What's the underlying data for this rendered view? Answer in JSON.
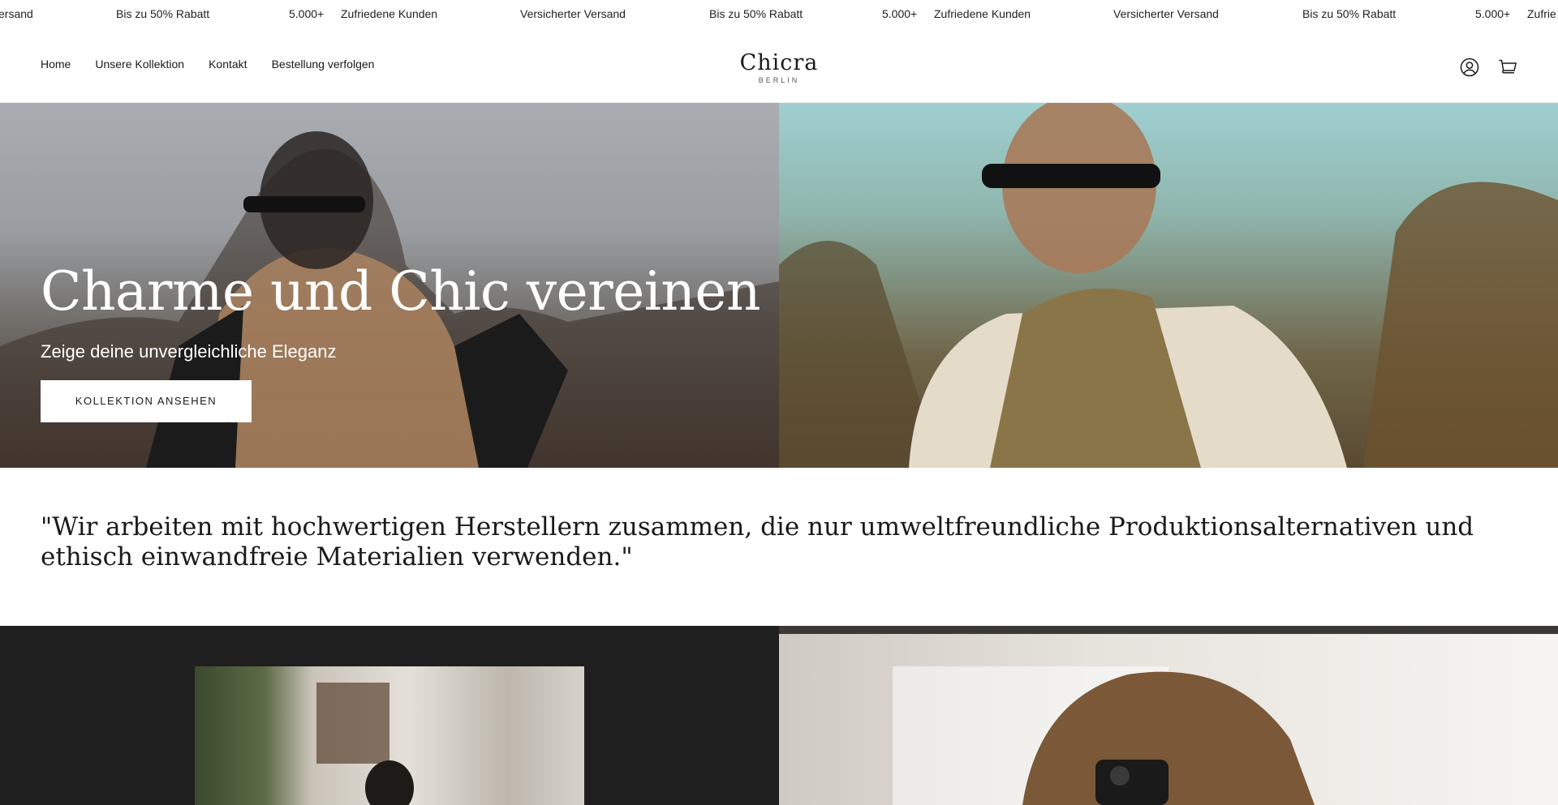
{
  "announcement": {
    "items": [
      "ersand",
      "Bis zu 50% Rabatt",
      "5.000+",
      "Zufriedene Kunden",
      "Versicherter Versand",
      "Bis zu 50% Rabatt",
      "5.000+",
      "Zufriedene Kunden",
      "Versicherter Versand",
      "Bis zu 50% Rabatt",
      "5.000+",
      "Zufrie"
    ]
  },
  "header": {
    "nav": [
      "Home",
      "Unsere Kollektion",
      "Kontakt",
      "Bestellung verfolgen"
    ],
    "logo": {
      "word": "Chicra",
      "sub": "BERLIN"
    },
    "icons": [
      "account-icon",
      "cart-icon"
    ]
  },
  "hero": {
    "title": "Charme und Chic vereinen",
    "subtitle": "Zeige deine unvergleichliche Eleganz",
    "button": "KOLLEKTION ANSEHEN"
  },
  "quote": {
    "text": "\"Wir arbeiten mit hochwertigen Herstellern zusammen, die nur umweltfreundliche Produktionsalternativen und ethisch einwandfreie Materialien verwenden.\""
  },
  "colors": {
    "dark_panel": "#1f1f1f",
    "button_bg": "#ffffff"
  }
}
